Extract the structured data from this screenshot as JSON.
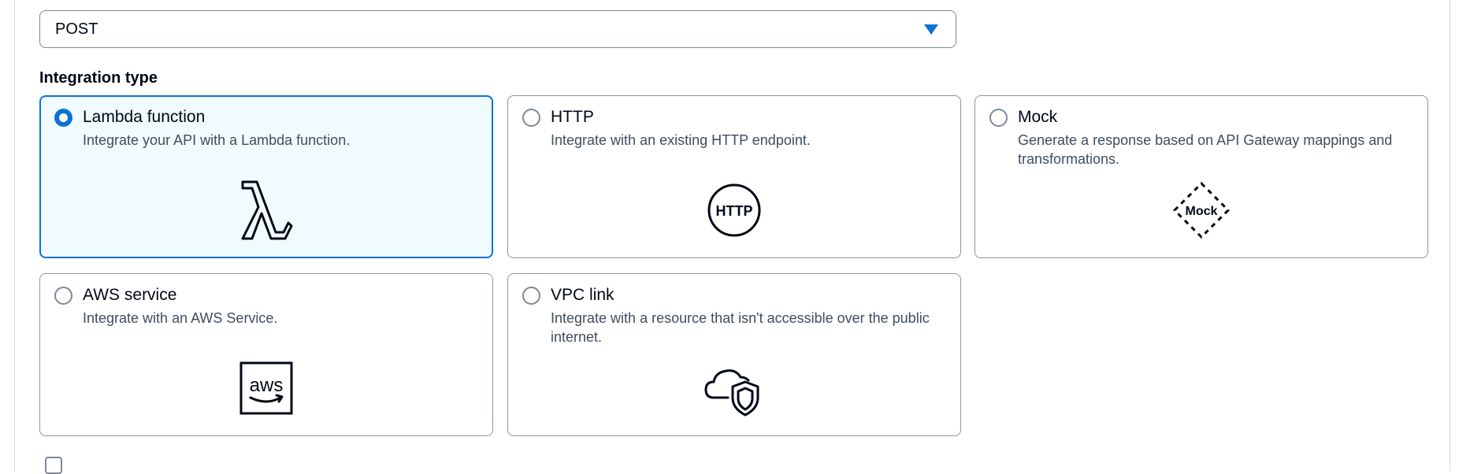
{
  "method_select": {
    "value": "POST"
  },
  "integration_type": {
    "label": "Integration type",
    "options": [
      {
        "title": "Lambda function",
        "description": "Integrate your API with a Lambda function.",
        "icon": "lambda-icon",
        "selected": true
      },
      {
        "title": "HTTP",
        "description": "Integrate with an existing HTTP endpoint.",
        "icon": "http-icon",
        "icon_text": "HTTP",
        "selected": false
      },
      {
        "title": "Mock",
        "description": "Generate a response based on API Gateway mappings and transformations.",
        "icon": "mock-icon",
        "icon_text": "Mock",
        "selected": false
      },
      {
        "title": "AWS service",
        "description": "Integrate with an AWS Service.",
        "icon": "aws-logo-icon",
        "icon_text": "aws",
        "selected": false
      },
      {
        "title": "VPC link",
        "description": "Integrate with a resource that isn't accessible over the public internet.",
        "icon": "cloud-shield-icon",
        "selected": false
      }
    ]
  },
  "colors": {
    "accent": "#0972d3",
    "selected_bg": "#f0fbff",
    "border": "#8c95a3",
    "text": "#000716",
    "muted_text": "#414d5c"
  }
}
